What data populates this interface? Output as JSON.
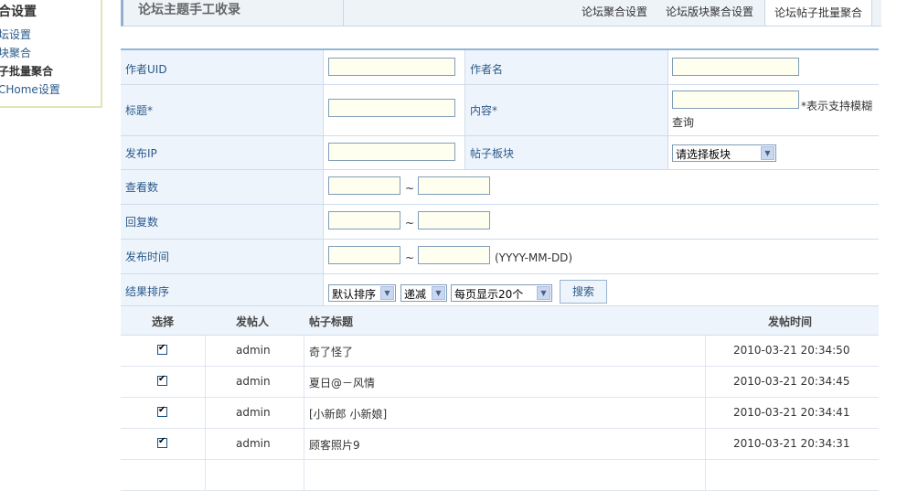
{
  "sidebar": {
    "title": "合设置",
    "items": [
      {
        "label": "坛设置"
      },
      {
        "label": "块聚合"
      },
      {
        "label": "子批量聚合"
      },
      {
        "label": "CHome设置"
      }
    ]
  },
  "header": {
    "title": "论坛主题手工收录",
    "tabs": [
      {
        "label": "论坛聚合设置"
      },
      {
        "label": "论坛版块聚合设置"
      },
      {
        "label": "论坛帖子批量聚合"
      }
    ]
  },
  "form": {
    "author_uid_label": "作者UID",
    "author_name_label": "作者名",
    "title_label": "标题*",
    "content_label": "内容*",
    "fuzzy_hint": "*表示支持模糊",
    "fuzzy_hint2": "查询",
    "ip_label": "发布IP",
    "forum_label": "帖子板块",
    "forum_select": "请选择板块",
    "views_label": "查看数",
    "replies_label": "回复数",
    "time_label": "发布时间",
    "time_hint": "(YYYY-MM-DD)",
    "tilde": "~",
    "sort_label": "结果排序",
    "sort_select": "默认排序",
    "order_select": "递减",
    "perpage_select": "每页显示20个",
    "search_button": "搜索"
  },
  "results": {
    "headers": {
      "select": "选择",
      "author": "发帖人",
      "title": "帖子标题",
      "time": "发帖时间"
    },
    "rows": [
      {
        "author": "admin",
        "title": "奇了怪了",
        "time": "2010-03-21 20:34:50",
        "checked": true
      },
      {
        "author": "admin",
        "title": "夏日@－风情",
        "time": "2010-03-21 20:34:45",
        "checked": true
      },
      {
        "author": "admin",
        "title": "[小新郎 小新娘]",
        "time": "2010-03-21 20:34:41",
        "checked": true
      },
      {
        "author": "admin",
        "title": "顾客照片9",
        "time": "2010-03-21 20:34:31",
        "checked": true
      }
    ]
  }
}
